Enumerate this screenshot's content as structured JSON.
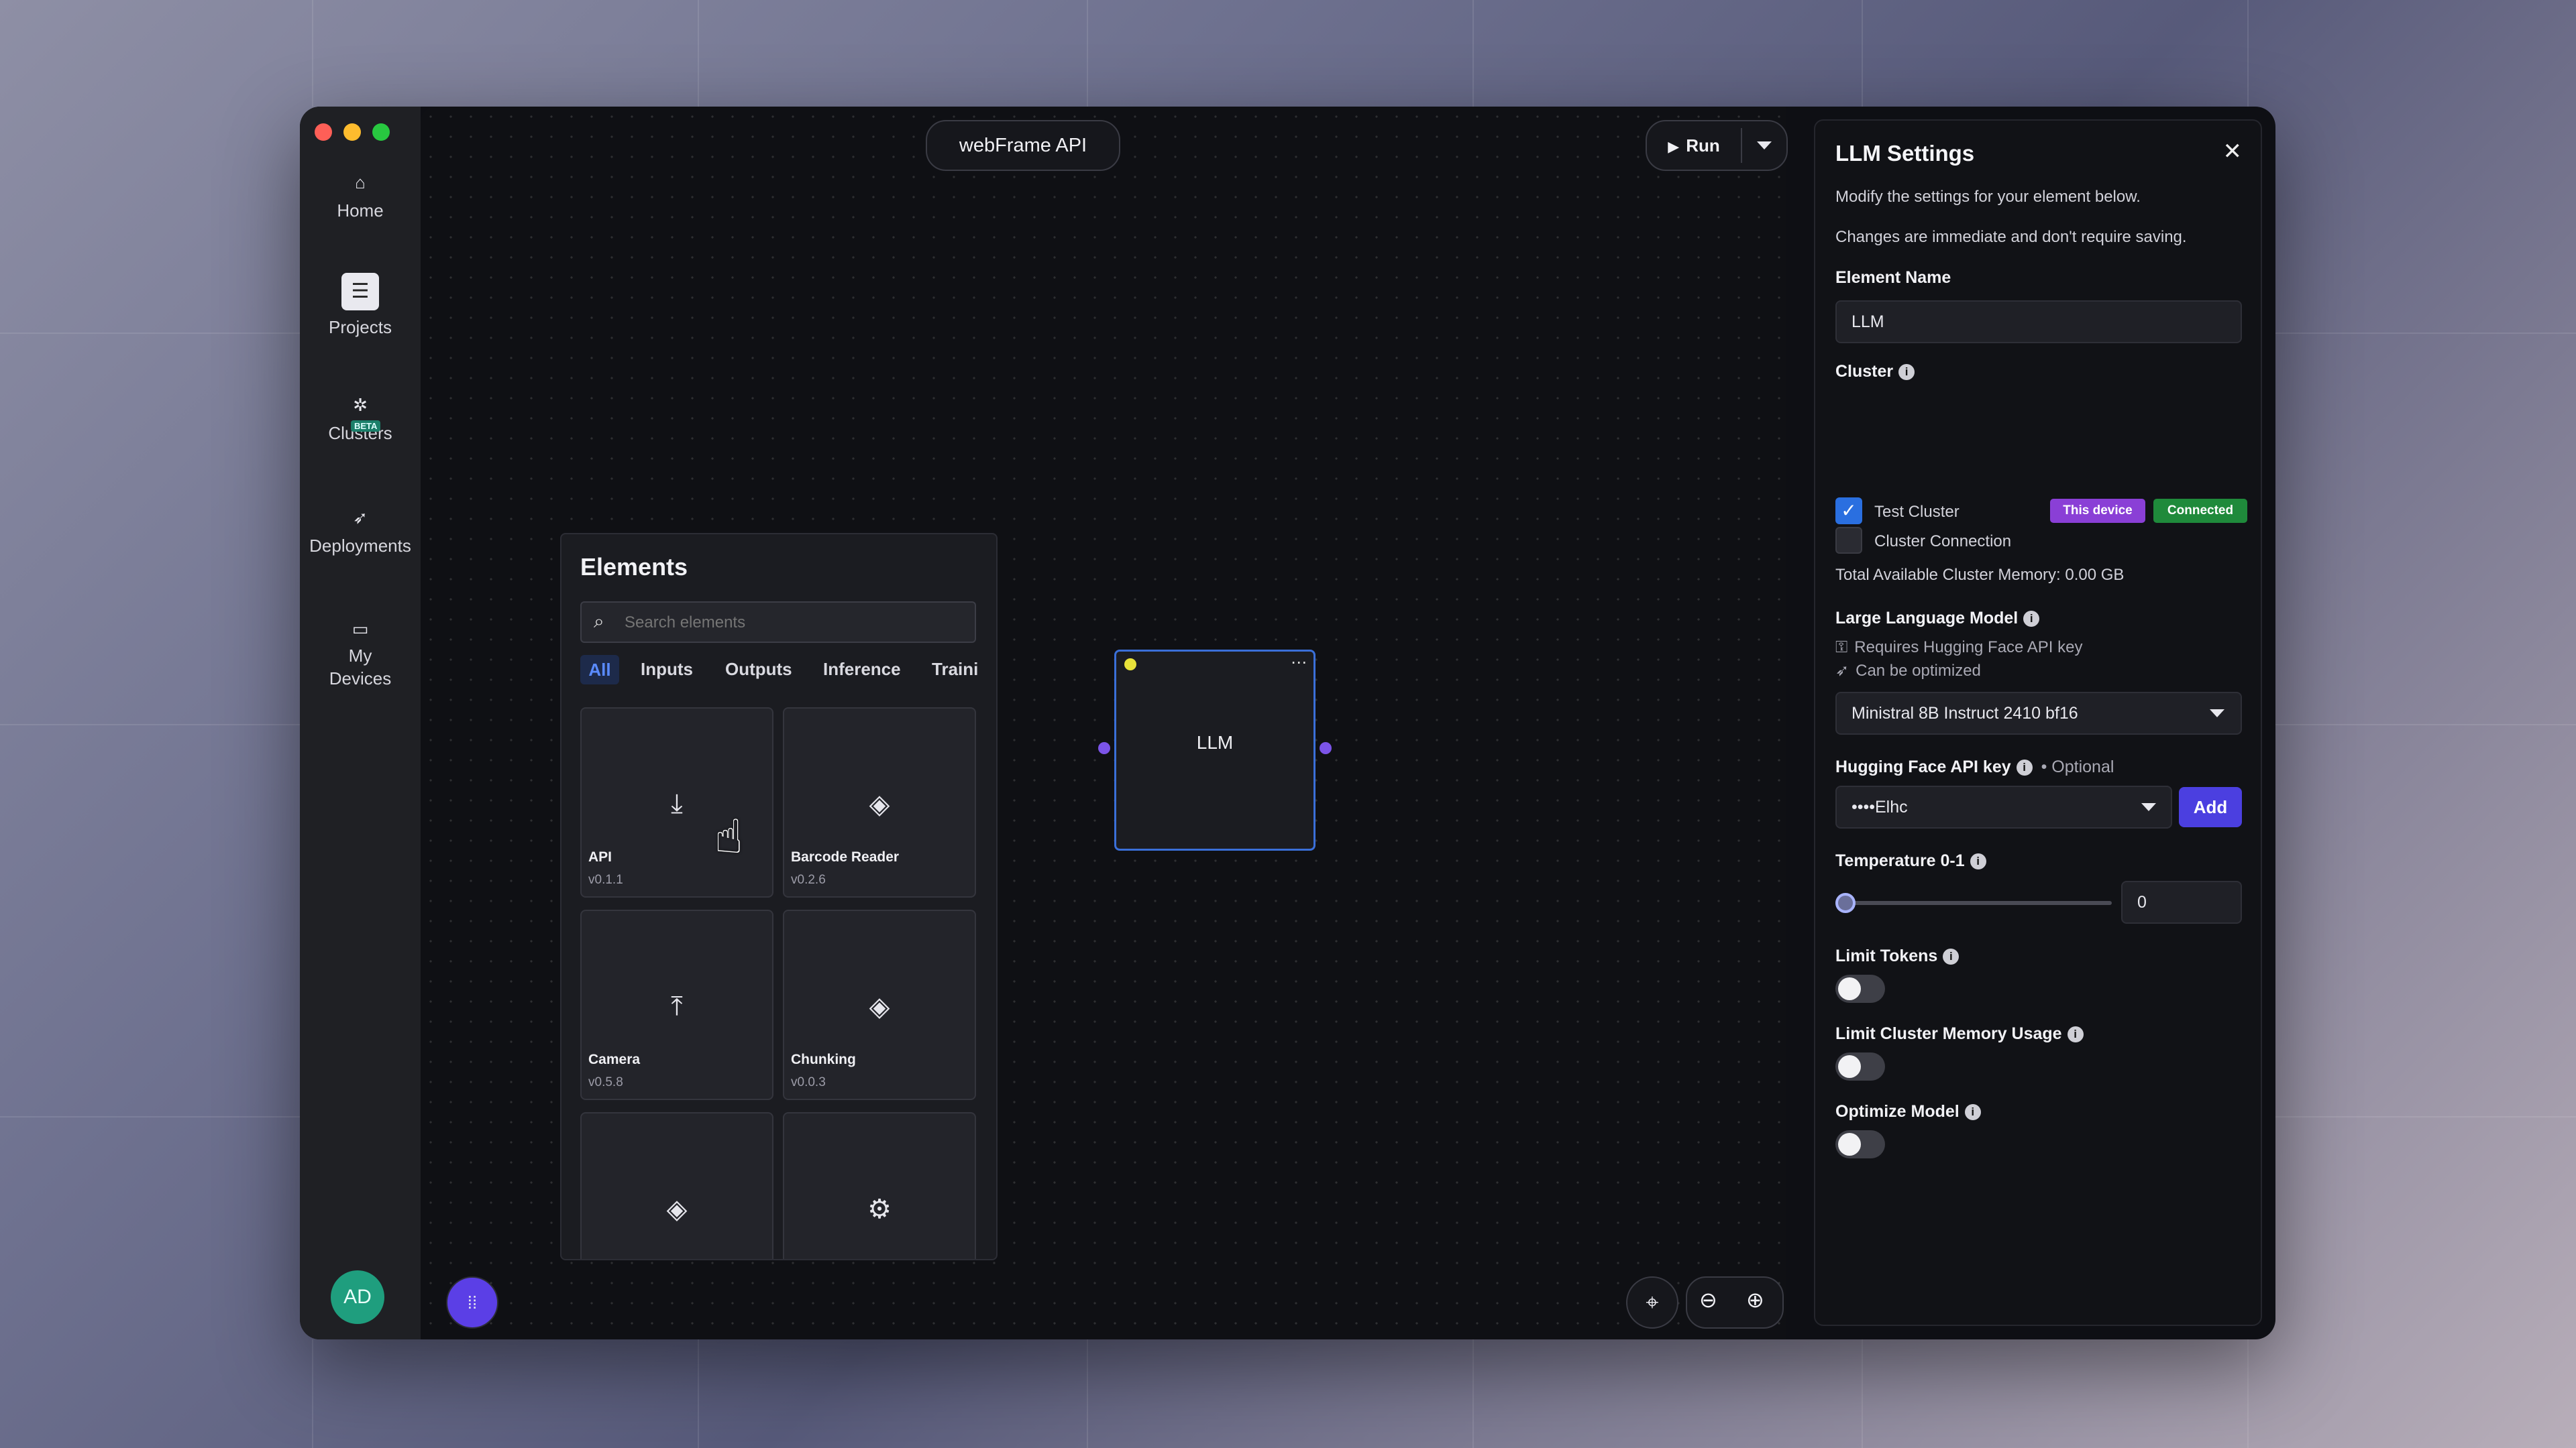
{
  "sidebar": {
    "items": [
      {
        "label": "Home",
        "icon": "home-icon"
      },
      {
        "label": "Projects",
        "icon": "projects-icon"
      },
      {
        "label": "Clusters",
        "icon": "clusters-icon",
        "badge": "BETA"
      },
      {
        "label": "Deployments",
        "icon": "rocket-icon"
      },
      {
        "label": "My Devices",
        "icon": "devices-icon"
      }
    ],
    "avatar": "AD"
  },
  "canvas": {
    "project_title": "webFrame API",
    "run_label": "Run",
    "node_label": "LLM"
  },
  "elements": {
    "title": "Elements",
    "search_placeholder": "Search elements",
    "tabs": [
      "All",
      "Inputs",
      "Outputs",
      "Inference",
      "Traini"
    ],
    "cards": [
      {
        "name": "API",
        "version": "v0.1.1",
        "icon": "download-icon"
      },
      {
        "name": "Barcode Reader",
        "version": "v0.2.6",
        "icon": "shapes-icon"
      },
      {
        "name": "Camera",
        "version": "v0.5.8",
        "icon": "upload-icon"
      },
      {
        "name": "Chunking",
        "version": "v0.0.3",
        "icon": "shapes-icon"
      },
      {
        "name": "",
        "version": "",
        "icon": "shapes-icon"
      },
      {
        "name": "",
        "version": "",
        "icon": "chip-icon"
      }
    ]
  },
  "settings": {
    "title": "LLM Settings",
    "desc1": "Modify the settings for your element below.",
    "desc2": "Changes are immediate and don't require saving.",
    "element_name_label": "Element Name",
    "element_name_value": "LLM",
    "cluster_label": "Cluster",
    "clusters": [
      {
        "name": "Test Cluster",
        "checked": true,
        "badges": [
          "This device",
          "Connected"
        ]
      },
      {
        "name": "Cluster Connection",
        "checked": false,
        "badges": []
      }
    ],
    "memory_text": "Total Available Cluster Memory: 0.00 GB",
    "llm_label": "Large Language Model",
    "llm_note1": "Requires Hugging Face API key",
    "llm_note2": "Can be optimized",
    "llm_selected": "Ministral 8B Instruct 2410 bf16",
    "hf_label": "Hugging Face API key",
    "hf_optional": "• Optional",
    "hf_value": "••••Elhc",
    "hf_add": "Add",
    "temp_label": "Temperature 0-1",
    "temp_value": "0",
    "limit_tokens_label": "Limit Tokens",
    "limit_memory_label": "Limit Cluster Memory Usage",
    "optimize_label": "Optimize Model"
  },
  "colors": {
    "accent": "#4b3fe0",
    "this_device": "#8a3fd6",
    "connected": "#1f8a3b",
    "checkbox": "#2a6fe0"
  }
}
